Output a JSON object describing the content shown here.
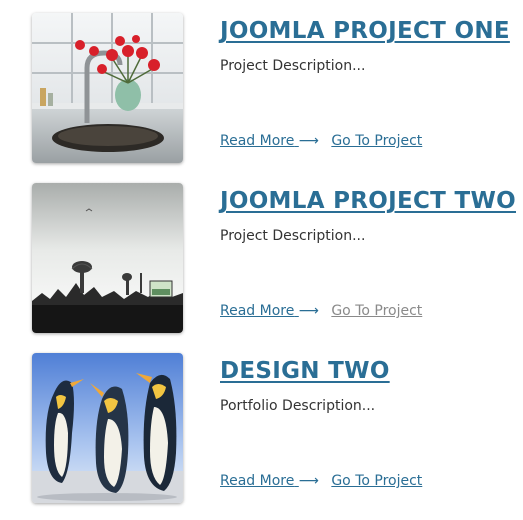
{
  "projects": [
    {
      "title": "JOOMLA PROJECT ONE",
      "description": "Project Description...",
      "read_more": "Read More",
      "arrow": "⟶",
      "go_to": "Go To Project",
      "go_to_color": "#2a6e95",
      "thumbnail": "kitchen-sink-flowers-image"
    },
    {
      "title": "JOOMLA PROJECT TWO",
      "description": "Project Description...",
      "read_more": "Read More",
      "arrow": "⟶",
      "go_to": "Go To Project",
      "go_to_color": "#8a8a8a",
      "thumbnail": "surreal-grey-landscape-image"
    },
    {
      "title": "DESIGN TWO",
      "description": "Portfolio Description...",
      "read_more": "Read More",
      "arrow": "⟶",
      "go_to": "Go To Project",
      "go_to_color": "#2a6e95",
      "thumbnail": "penguins-image"
    }
  ],
  "colors": {
    "link": "#2a6e95",
    "text": "#333333",
    "muted": "#8a8a8a"
  }
}
